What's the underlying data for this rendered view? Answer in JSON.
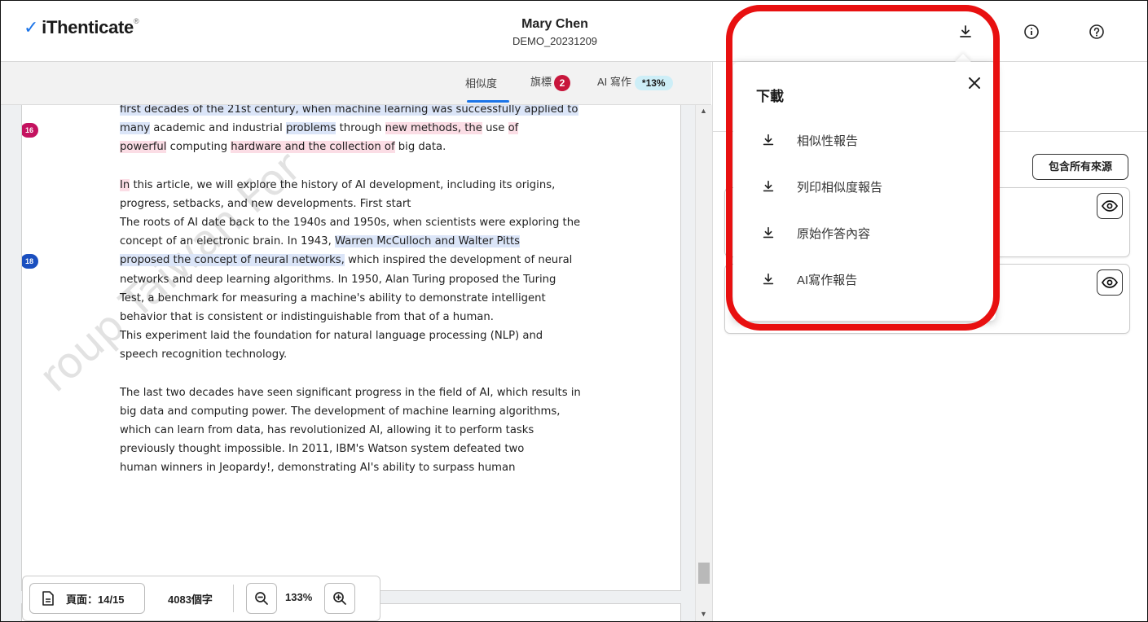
{
  "header": {
    "logo": "iThenticate",
    "user_name": "Mary Chen",
    "document": "DEMO_20231209",
    "icons": [
      "download-icon",
      "info-icon",
      "help-icon"
    ]
  },
  "tabs": {
    "similarity": "相似度",
    "flags": "旗標",
    "flags_count": "2",
    "ai": "AI 寫作",
    "ai_percent": "*13%"
  },
  "document": {
    "markers": [
      "16",
      "18"
    ],
    "watermark": "roup Taiwan For",
    "para1": {
      "l1": "first decades of the 21st century, when machine learning was successfully applied to",
      "l2_a": "many",
      "l2_b": " academic and industrial ",
      "l2_c": "problems",
      "l2_d": " through ",
      "l2_e": "new methods, the",
      "l2_f": " use ",
      "l2_g": "of",
      "l3_a": "powerful",
      "l3_b": " computing ",
      "l3_c": "hardware and the collection of",
      "l3_d": " big data."
    },
    "para2": {
      "l1_a": "In",
      "l1_b": " this article, we will explore the history of AI development, including its origins,",
      "l2": "progress, setbacks, and new developments. First start",
      "l3": "The roots of AI date back to the 1940s and 1950s, when scientists were exploring the",
      "l4_a": "concept of an electronic brain. In 1943, ",
      "l4_b": "Warren McCulloch and Walter Pitts",
      "l5_a": "proposed the concept of neural networks,",
      "l5_b": " which inspired the development of neural",
      "l6": "networks and deep learning algorithms. In 1950, Alan Turing proposed the Turing",
      "l7": "Test, a benchmark for measuring a machine's ability to demonstrate intelligent",
      "l8": "behavior that is consistent or indistinguishable from that of a human.",
      "l9": "This experiment laid the foundation for natural language processing (NLP) and",
      "l10": "speech recognition technology."
    },
    "para3": {
      "l1": "The last two decades have seen significant progress in the field of AI, which results in",
      "l2": "big data and computing power. The development of machine learning algorithms,",
      "l3": "which can learn from data, has revolutionized AI, allowing it to perform tasks",
      "l4": "previously thought impossible. In 2011, IBM's Watson system defeated two",
      "l5": "human winners in Jeopardy!, demonstrating AI's ability to surpass human"
    }
  },
  "bottom_bar": {
    "page_label": "頁面：14/15",
    "words": "4083個字",
    "zoom": "133%"
  },
  "right_panel": {
    "include_all_sources": "包含所有來源"
  },
  "download_menu": {
    "title": "下載",
    "items": [
      "相似性報告",
      "列印相似度報告",
      "原始作答內容",
      "AI寫作報告"
    ]
  },
  "colors": {
    "accent": "#1b74e8",
    "flag_badge": "#c8163c",
    "ai_badge": "#cdeef7",
    "marker_16": "#c4125f",
    "marker_18": "#1a4fbf",
    "highlight_ring": "#e81010"
  }
}
